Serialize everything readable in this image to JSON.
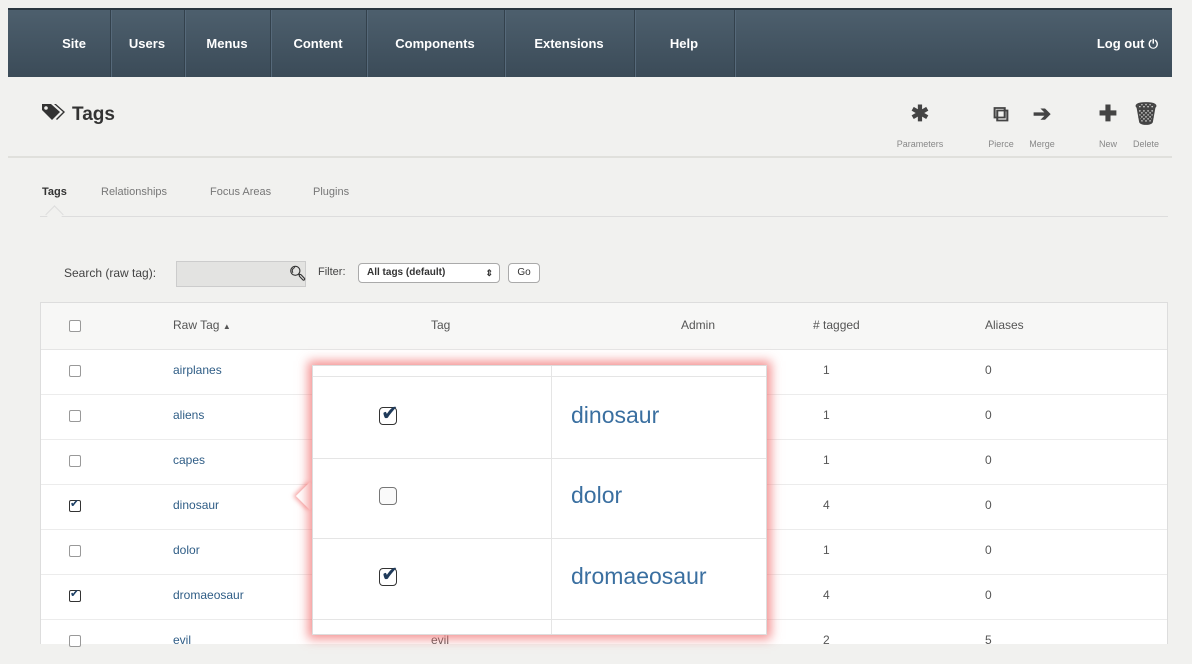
{
  "nav": {
    "items": [
      "Site",
      "Users",
      "Menus",
      "Content",
      "Components",
      "Extensions",
      "Help"
    ],
    "logout_label": "Log out"
  },
  "header": {
    "title": "Tags",
    "toolbar": {
      "parameters_label": "Parameters",
      "pierce_label": "Pierce",
      "merge_label": "Merge",
      "new_label": "New",
      "delete_label": "Delete"
    }
  },
  "tabs": [
    {
      "label": "Tags",
      "active": true
    },
    {
      "label": "Relationships",
      "active": false
    },
    {
      "label": "Focus Areas",
      "active": false
    },
    {
      "label": "Plugins",
      "active": false
    }
  ],
  "search": {
    "label": "Search (raw tag):",
    "value": "",
    "filter_label": "Filter:",
    "filter_value": "All tags (default)",
    "go_label": "Go"
  },
  "table": {
    "headers": [
      "Raw Tag",
      "Tag",
      "Admin",
      "# tagged",
      "Aliases"
    ],
    "sort_indicator": "▲",
    "rows": [
      {
        "raw": "airplanes",
        "tag": "",
        "admin": "",
        "tagged": "1",
        "aliases": "0",
        "checked": false
      },
      {
        "raw": "aliens",
        "tag": "",
        "admin": "",
        "tagged": "1",
        "aliases": "0",
        "checked": false
      },
      {
        "raw": "capes",
        "tag": "",
        "admin": "",
        "tagged": "1",
        "aliases": "0",
        "checked": false
      },
      {
        "raw": "dinosaur",
        "tag": "",
        "admin": "",
        "tagged": "4",
        "aliases": "0",
        "checked": true
      },
      {
        "raw": "dolor",
        "tag": "",
        "admin": "",
        "tagged": "1",
        "aliases": "0",
        "checked": false
      },
      {
        "raw": "dromaeosaur",
        "tag": "",
        "admin": "",
        "tagged": "4",
        "aliases": "0",
        "checked": true
      },
      {
        "raw": "evil",
        "tag": "evil",
        "admin": "",
        "tagged": "2",
        "aliases": "5",
        "checked": false
      }
    ]
  },
  "popup": {
    "rows": [
      {
        "name": "dinosaur",
        "checked": true
      },
      {
        "name": "dolor",
        "checked": false
      },
      {
        "name": "dromaeosaur",
        "checked": true
      }
    ]
  }
}
